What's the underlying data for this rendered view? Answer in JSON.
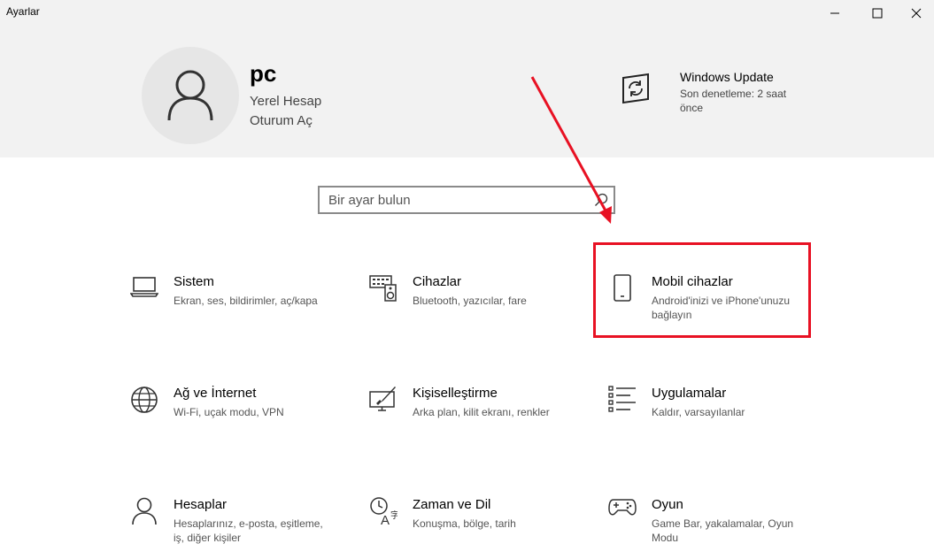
{
  "window": {
    "title": "Ayarlar"
  },
  "account": {
    "name": "pc",
    "type": "Yerel Hesap",
    "signin": "Oturum Aç"
  },
  "update": {
    "title": "Windows Update",
    "subtitle": "Son denetleme: 2 saat önce"
  },
  "search": {
    "placeholder": "Bir ayar bulun"
  },
  "tiles": [
    {
      "icon": "laptop-icon",
      "title": "Sistem",
      "desc": "Ekran, ses, bildirimler, aç/kapa"
    },
    {
      "icon": "keyboard-speaker-icon",
      "title": "Cihazlar",
      "desc": "Bluetooth, yazıcılar, fare"
    },
    {
      "icon": "phone-icon",
      "title": "Mobil cihazlar",
      "desc": "Android'inizi ve iPhone'unuzu bağlayın"
    },
    {
      "icon": "globe-icon",
      "title": "Ağ ve İnternet",
      "desc": "Wi-Fi, uçak modu, VPN"
    },
    {
      "icon": "paint-icon",
      "title": "Kişiselleştirme",
      "desc": "Arka plan, kilit ekranı, renkler"
    },
    {
      "icon": "apps-list-icon",
      "title": "Uygulamalar",
      "desc": "Kaldır, varsayılanlar"
    },
    {
      "icon": "person-icon",
      "title": "Hesaplar",
      "desc": "Hesaplarınız, e-posta, eşitleme, iş, diğer kişiler"
    },
    {
      "icon": "time-language-icon",
      "title": "Zaman ve Dil",
      "desc": "Konuşma, bölge, tarih"
    },
    {
      "icon": "gamepad-icon",
      "title": "Oyun",
      "desc": "Game Bar, yakalamalar, Oyun Modu"
    }
  ],
  "annotation": {
    "color": "#e81123"
  }
}
